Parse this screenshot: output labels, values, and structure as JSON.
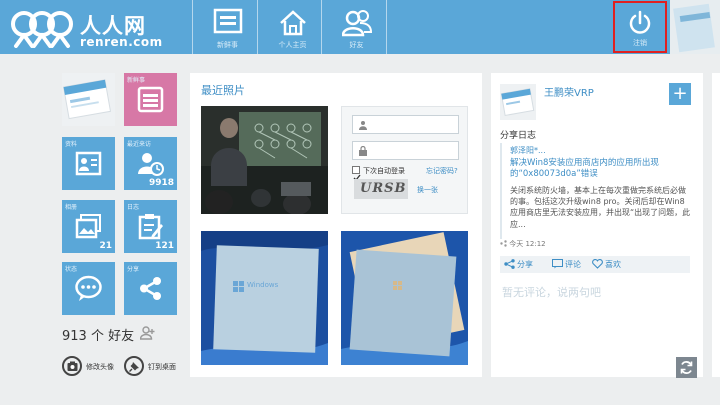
{
  "header": {
    "logo_text": "人人网",
    "logo_url": "renren.com",
    "nav": [
      {
        "label": "新鲜事"
      },
      {
        "label": "个人主页"
      },
      {
        "label": "好友"
      }
    ],
    "logout_label": "注销"
  },
  "tiles": {
    "news": {
      "label": "新鲜事"
    },
    "profile": {
      "label": "资料"
    },
    "visitors": {
      "label": "最近来访",
      "count": "9918"
    },
    "album": {
      "label": "相册",
      "count": "21"
    },
    "blog": {
      "label": "日志",
      "count": "121"
    },
    "status": {
      "label": "状态"
    },
    "share": {
      "label": "分享"
    }
  },
  "friends": {
    "text": "913 个 好友"
  },
  "actions": {
    "change_avatar": "修改头像",
    "pin_desktop": "钉到桌面"
  },
  "photos": {
    "title": "最近照片",
    "login_card": {
      "remember": "下次自动登录",
      "forgot": "忘记密码?",
      "captcha": "URSB",
      "refresh": "换一张"
    },
    "windows_text": "Windows"
  },
  "feed": {
    "author": "王鹏荣VRP",
    "action": "分享日志",
    "ref": "郭泽阳*...",
    "post_title": "解决Win8安装应用商店内的应用所出现的“0x80073d0a”错误",
    "post_body": "关闭系统防火墙，基本上在每次重做完系统后必做的事。包括这次升级win8 pro。关闭后却在Win8 应用商店里无法安装应用，并出现“出现了问题，此应...",
    "time": "今天 12:12",
    "share": "分享",
    "comment": "评论",
    "like": "喜欢",
    "no_comment": "暂无评论，说两句吧"
  },
  "colors": {
    "accent": "#5aa7d8",
    "tile_pink": "#d778a6",
    "link": "#3e8ec5",
    "logout_highlight": "#e02020"
  }
}
